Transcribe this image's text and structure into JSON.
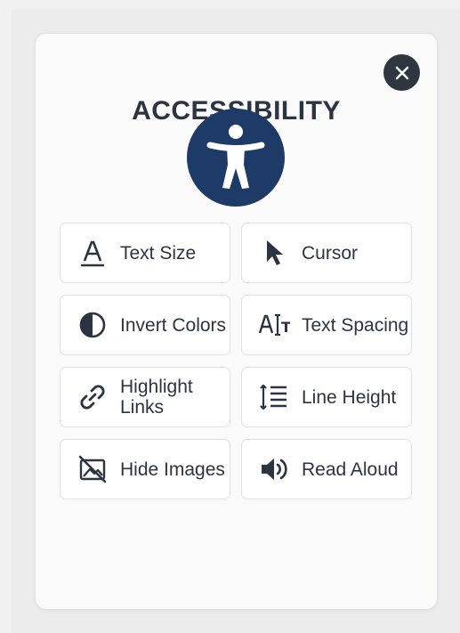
{
  "panel": {
    "title": "ACCESSIBILITY"
  },
  "icons": {
    "close": "close-icon",
    "hero": "accessibility-person-icon"
  },
  "colors": {
    "hero_background": "#1e3a66",
    "close_background": "#2e363f",
    "text": "#2b3440",
    "button_border": "#e1e1e3"
  },
  "options": [
    {
      "label": "Text Size",
      "icon": "text-size-icon"
    },
    {
      "label": "Cursor",
      "icon": "cursor-icon"
    },
    {
      "label": "Invert Colors",
      "icon": "invert-colors-icon"
    },
    {
      "label": "Text Spacing",
      "icon": "text-spacing-icon"
    },
    {
      "label": "Highlight Links",
      "icon": "link-icon"
    },
    {
      "label": "Line Height",
      "icon": "line-height-icon"
    },
    {
      "label": "Hide Images",
      "icon": "hide-images-icon"
    },
    {
      "label": "Read Aloud",
      "icon": "speaker-icon"
    }
  ]
}
